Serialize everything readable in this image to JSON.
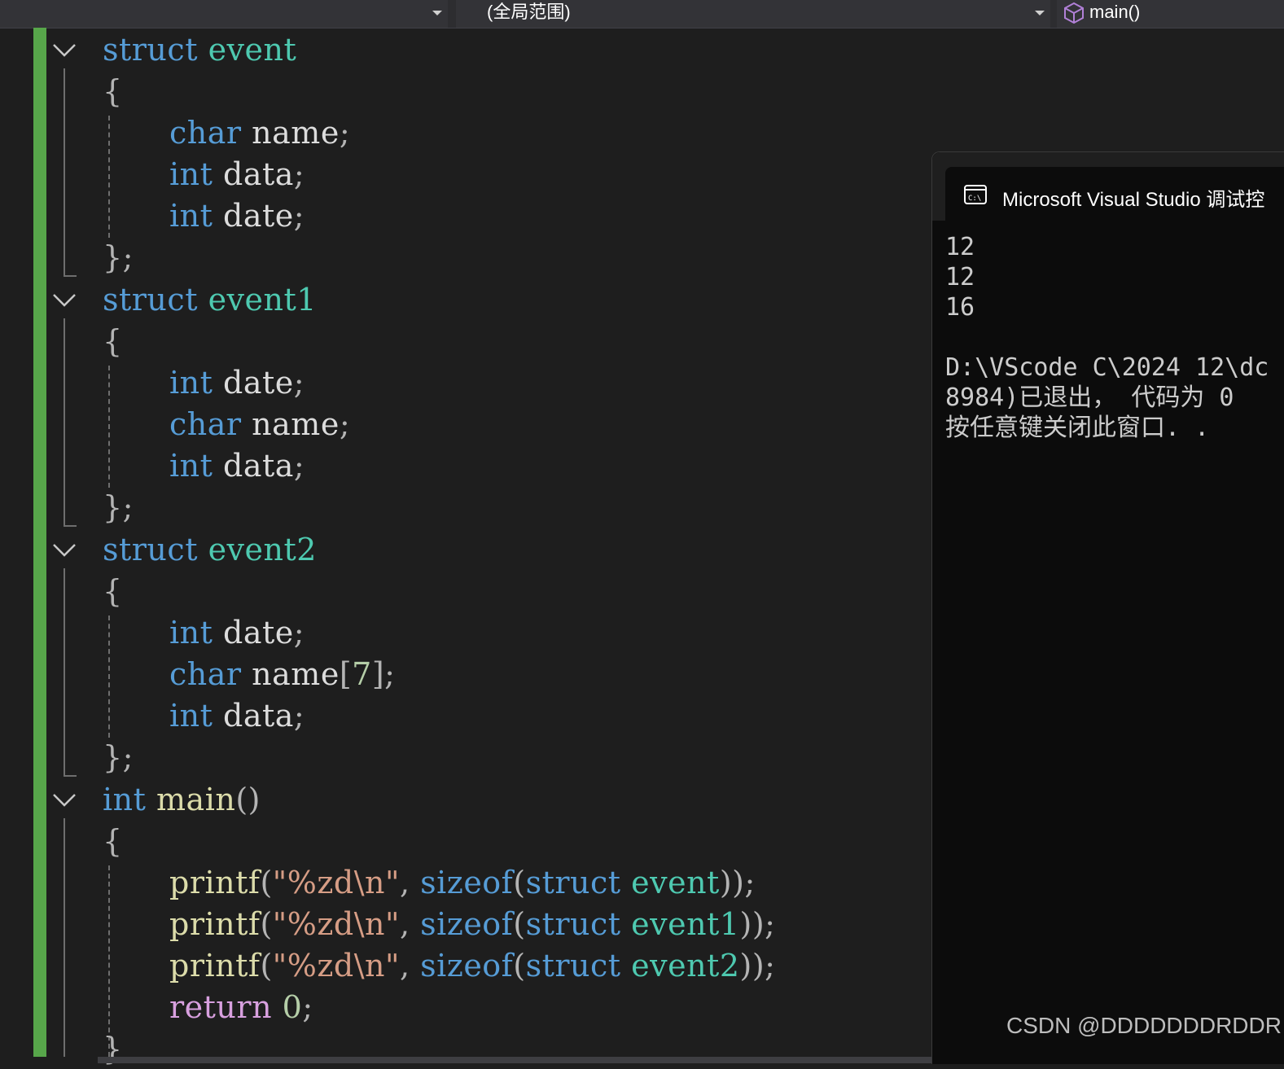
{
  "nav": {
    "scope": "(全局范围)",
    "member": "main()"
  },
  "colors": {
    "keyword": "#569cd6",
    "type": "#4ec9b0",
    "identifier": "#dcdcdc",
    "function": "#dcdcaa",
    "string": "#d69d85",
    "number": "#b5cea8",
    "control": "#d8a0df",
    "change_bar": "#57a64a"
  },
  "code": {
    "kw_struct": "struct",
    "kw_char": "char",
    "kw_int": "int",
    "kw_sizeof": "sizeof",
    "kw_return": "return",
    "t_event": "event",
    "t_event1": "event1",
    "t_event2": "event2",
    "id_name": "name",
    "id_data": "data",
    "id_date": "date",
    "fn_main": "main",
    "fn_printf": "printf",
    "str_fmt": "\"%zd\\n\"",
    "num_7": "7",
    "num_0": "0",
    "p_open_brace": "{",
    "p_close_brace_semi": "};",
    "p_close_brace": "}",
    "p_semi": ";",
    "p_parens": "()",
    "p_lparen": "(",
    "p_comma": ", ",
    "p_lbr": "[",
    "p_rbr_semi": "];",
    "p_close_call": "));",
    "sp": " "
  },
  "console": {
    "title": "Microsoft Visual Studio 调试控",
    "lines": [
      "12",
      "12",
      "16",
      "",
      "D:\\VScode C\\2024 12\\dc",
      "8984)已退出， 代码为 0",
      "按任意键关闭此窗口. ."
    ]
  },
  "watermark": "CSDN @DDDDDDDRDDR"
}
